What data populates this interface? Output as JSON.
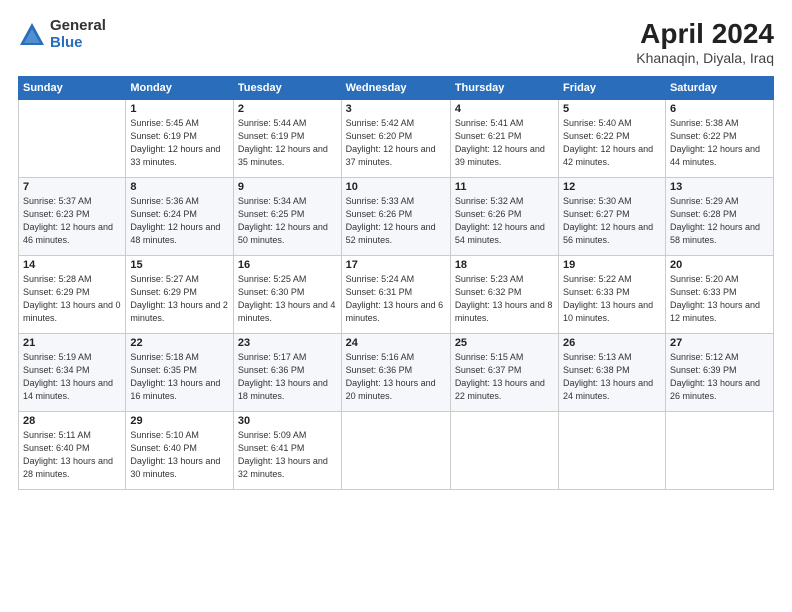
{
  "header": {
    "logo_general": "General",
    "logo_blue": "Blue",
    "month_title": "April 2024",
    "location": "Khanaqin, Diyala, Iraq"
  },
  "weekdays": [
    "Sunday",
    "Monday",
    "Tuesday",
    "Wednesday",
    "Thursday",
    "Friday",
    "Saturday"
  ],
  "weeks": [
    [
      {
        "day": "",
        "sunrise": "",
        "sunset": "",
        "daylight": ""
      },
      {
        "day": "1",
        "sunrise": "Sunrise: 5:45 AM",
        "sunset": "Sunset: 6:19 PM",
        "daylight": "Daylight: 12 hours and 33 minutes."
      },
      {
        "day": "2",
        "sunrise": "Sunrise: 5:44 AM",
        "sunset": "Sunset: 6:19 PM",
        "daylight": "Daylight: 12 hours and 35 minutes."
      },
      {
        "day": "3",
        "sunrise": "Sunrise: 5:42 AM",
        "sunset": "Sunset: 6:20 PM",
        "daylight": "Daylight: 12 hours and 37 minutes."
      },
      {
        "day": "4",
        "sunrise": "Sunrise: 5:41 AM",
        "sunset": "Sunset: 6:21 PM",
        "daylight": "Daylight: 12 hours and 39 minutes."
      },
      {
        "day": "5",
        "sunrise": "Sunrise: 5:40 AM",
        "sunset": "Sunset: 6:22 PM",
        "daylight": "Daylight: 12 hours and 42 minutes."
      },
      {
        "day": "6",
        "sunrise": "Sunrise: 5:38 AM",
        "sunset": "Sunset: 6:22 PM",
        "daylight": "Daylight: 12 hours and 44 minutes."
      }
    ],
    [
      {
        "day": "7",
        "sunrise": "Sunrise: 5:37 AM",
        "sunset": "Sunset: 6:23 PM",
        "daylight": "Daylight: 12 hours and 46 minutes."
      },
      {
        "day": "8",
        "sunrise": "Sunrise: 5:36 AM",
        "sunset": "Sunset: 6:24 PM",
        "daylight": "Daylight: 12 hours and 48 minutes."
      },
      {
        "day": "9",
        "sunrise": "Sunrise: 5:34 AM",
        "sunset": "Sunset: 6:25 PM",
        "daylight": "Daylight: 12 hours and 50 minutes."
      },
      {
        "day": "10",
        "sunrise": "Sunrise: 5:33 AM",
        "sunset": "Sunset: 6:26 PM",
        "daylight": "Daylight: 12 hours and 52 minutes."
      },
      {
        "day": "11",
        "sunrise": "Sunrise: 5:32 AM",
        "sunset": "Sunset: 6:26 PM",
        "daylight": "Daylight: 12 hours and 54 minutes."
      },
      {
        "day": "12",
        "sunrise": "Sunrise: 5:30 AM",
        "sunset": "Sunset: 6:27 PM",
        "daylight": "Daylight: 12 hours and 56 minutes."
      },
      {
        "day": "13",
        "sunrise": "Sunrise: 5:29 AM",
        "sunset": "Sunset: 6:28 PM",
        "daylight": "Daylight: 12 hours and 58 minutes."
      }
    ],
    [
      {
        "day": "14",
        "sunrise": "Sunrise: 5:28 AM",
        "sunset": "Sunset: 6:29 PM",
        "daylight": "Daylight: 13 hours and 0 minutes."
      },
      {
        "day": "15",
        "sunrise": "Sunrise: 5:27 AM",
        "sunset": "Sunset: 6:29 PM",
        "daylight": "Daylight: 13 hours and 2 minutes."
      },
      {
        "day": "16",
        "sunrise": "Sunrise: 5:25 AM",
        "sunset": "Sunset: 6:30 PM",
        "daylight": "Daylight: 13 hours and 4 minutes."
      },
      {
        "day": "17",
        "sunrise": "Sunrise: 5:24 AM",
        "sunset": "Sunset: 6:31 PM",
        "daylight": "Daylight: 13 hours and 6 minutes."
      },
      {
        "day": "18",
        "sunrise": "Sunrise: 5:23 AM",
        "sunset": "Sunset: 6:32 PM",
        "daylight": "Daylight: 13 hours and 8 minutes."
      },
      {
        "day": "19",
        "sunrise": "Sunrise: 5:22 AM",
        "sunset": "Sunset: 6:33 PM",
        "daylight": "Daylight: 13 hours and 10 minutes."
      },
      {
        "day": "20",
        "sunrise": "Sunrise: 5:20 AM",
        "sunset": "Sunset: 6:33 PM",
        "daylight": "Daylight: 13 hours and 12 minutes."
      }
    ],
    [
      {
        "day": "21",
        "sunrise": "Sunrise: 5:19 AM",
        "sunset": "Sunset: 6:34 PM",
        "daylight": "Daylight: 13 hours and 14 minutes."
      },
      {
        "day": "22",
        "sunrise": "Sunrise: 5:18 AM",
        "sunset": "Sunset: 6:35 PM",
        "daylight": "Daylight: 13 hours and 16 minutes."
      },
      {
        "day": "23",
        "sunrise": "Sunrise: 5:17 AM",
        "sunset": "Sunset: 6:36 PM",
        "daylight": "Daylight: 13 hours and 18 minutes."
      },
      {
        "day": "24",
        "sunrise": "Sunrise: 5:16 AM",
        "sunset": "Sunset: 6:36 PM",
        "daylight": "Daylight: 13 hours and 20 minutes."
      },
      {
        "day": "25",
        "sunrise": "Sunrise: 5:15 AM",
        "sunset": "Sunset: 6:37 PM",
        "daylight": "Daylight: 13 hours and 22 minutes."
      },
      {
        "day": "26",
        "sunrise": "Sunrise: 5:13 AM",
        "sunset": "Sunset: 6:38 PM",
        "daylight": "Daylight: 13 hours and 24 minutes."
      },
      {
        "day": "27",
        "sunrise": "Sunrise: 5:12 AM",
        "sunset": "Sunset: 6:39 PM",
        "daylight": "Daylight: 13 hours and 26 minutes."
      }
    ],
    [
      {
        "day": "28",
        "sunrise": "Sunrise: 5:11 AM",
        "sunset": "Sunset: 6:40 PM",
        "daylight": "Daylight: 13 hours and 28 minutes."
      },
      {
        "day": "29",
        "sunrise": "Sunrise: 5:10 AM",
        "sunset": "Sunset: 6:40 PM",
        "daylight": "Daylight: 13 hours and 30 minutes."
      },
      {
        "day": "30",
        "sunrise": "Sunrise: 5:09 AM",
        "sunset": "Sunset: 6:41 PM",
        "daylight": "Daylight: 13 hours and 32 minutes."
      },
      {
        "day": "",
        "sunrise": "",
        "sunset": "",
        "daylight": ""
      },
      {
        "day": "",
        "sunrise": "",
        "sunset": "",
        "daylight": ""
      },
      {
        "day": "",
        "sunrise": "",
        "sunset": "",
        "daylight": ""
      },
      {
        "day": "",
        "sunrise": "",
        "sunset": "",
        "daylight": ""
      }
    ]
  ]
}
